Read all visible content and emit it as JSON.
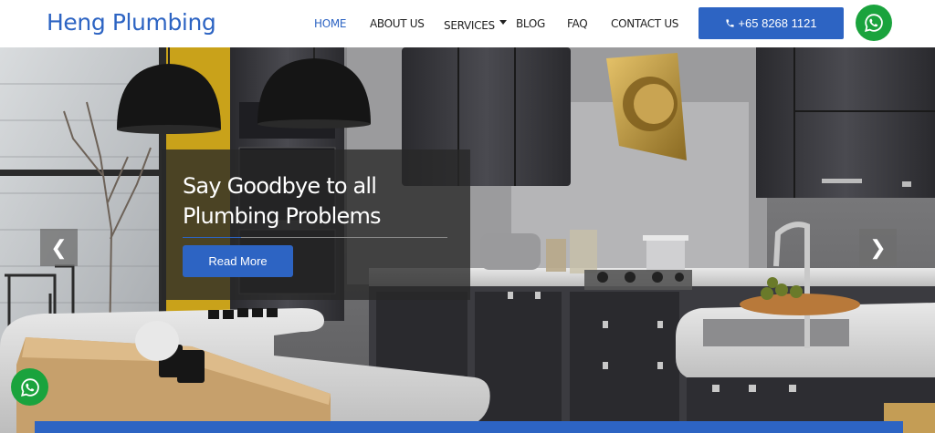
{
  "header": {
    "logo": "Heng Plumbing",
    "nav": [
      {
        "label": "HOME",
        "active": true
      },
      {
        "label": "ABOUT US",
        "active": false
      },
      {
        "label": "SERVICES",
        "active": false,
        "has_dropdown": true
      },
      {
        "label": "BLOG",
        "active": false
      },
      {
        "label": "FAQ",
        "active": false
      },
      {
        "label": "CONTACT US",
        "active": false
      }
    ],
    "phone_label": "+65 8268 1121",
    "phone_icon": "phone-icon",
    "whatsapp_icon": "whatsapp-icon"
  },
  "hero": {
    "title": "Say Goodbye to all Plumbing Problems",
    "button_label": "Read More",
    "prev_arrow": "❮",
    "next_arrow": "❯"
  },
  "floating": {
    "whatsapp_icon": "whatsapp-icon"
  },
  "colors": {
    "brand_blue": "#2d64c3",
    "whatsapp_green": "#1aa33d",
    "caption_bg": "rgba(40,40,40,0.78)"
  }
}
